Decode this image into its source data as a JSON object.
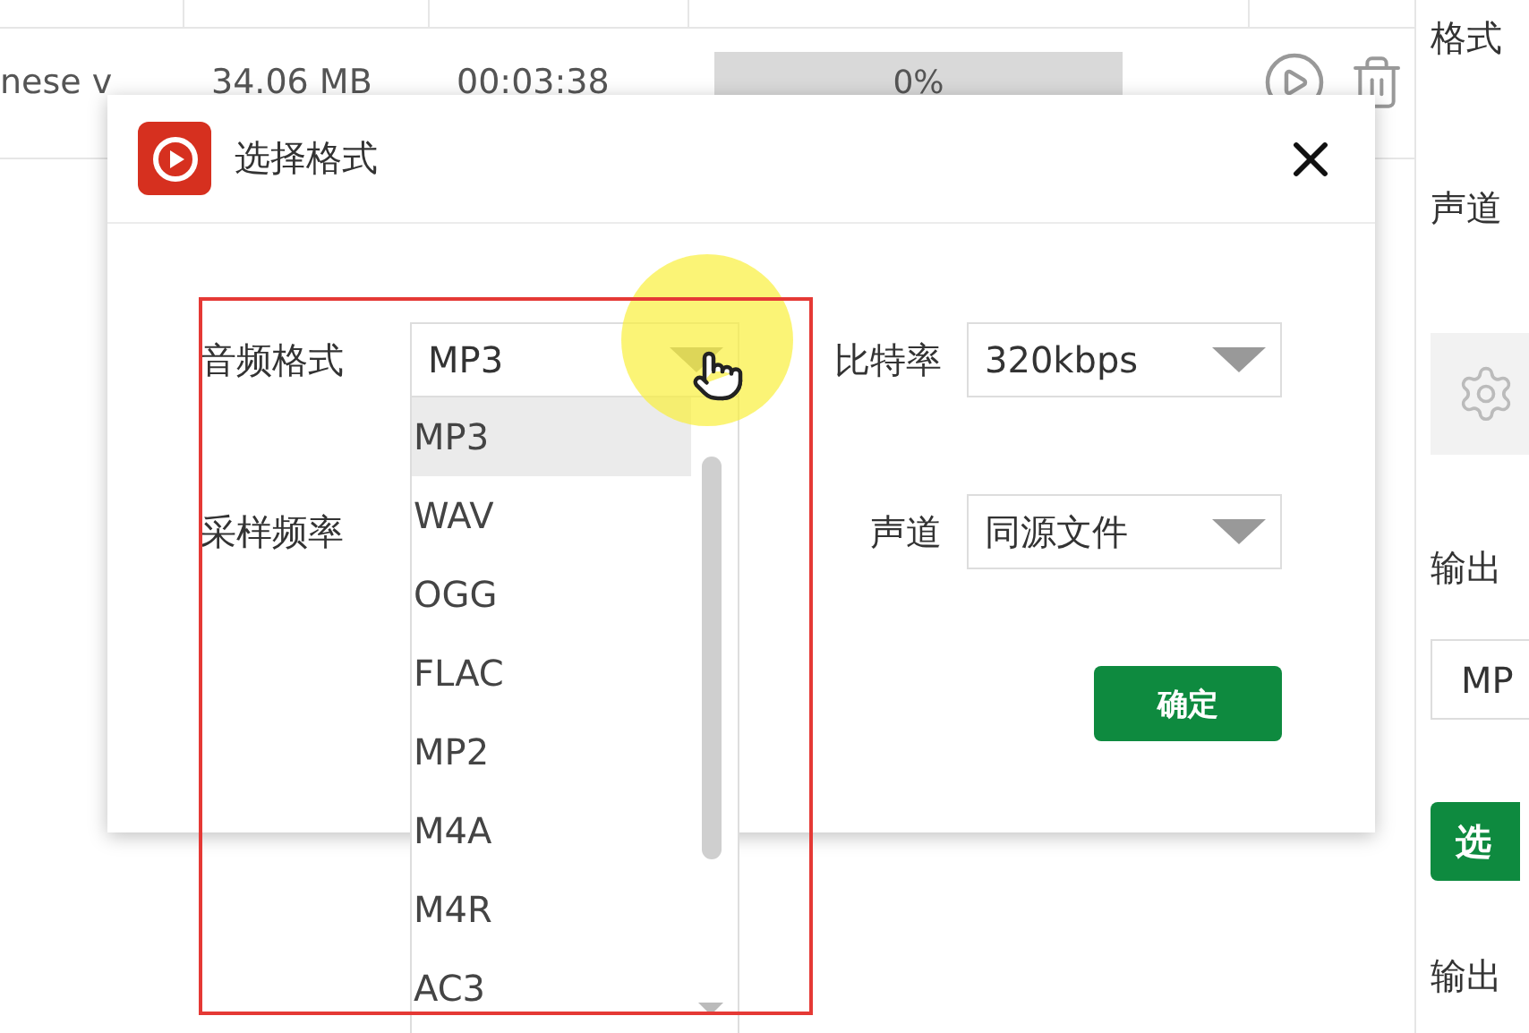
{
  "file_table": {
    "rows": [
      {
        "cells": [
          "nese v",
          "34.06 MB",
          "00:03:38"
        ],
        "progress": {
          "level": 0,
          "reading": "0%"
        }
      }
    ]
  },
  "side_panel": [
    {
      "kind": "label",
      "text": "格式"
    },
    {
      "kind": "label",
      "text": "声道"
    },
    {
      "kind": "settings"
    },
    {
      "kind": "label",
      "text": "输出"
    },
    {
      "kind": "field",
      "value": "MP"
    },
    {
      "kind": "button",
      "text": "选"
    },
    {
      "kind": "label",
      "text": "输出"
    }
  ],
  "dialog": {
    "title": "选择格式",
    "fields": [
      {
        "label": "音频格式",
        "value": "MP3"
      },
      {
        "label": "比特率",
        "value": "320kbps"
      },
      {
        "label": "采样频率"
      },
      {
        "label": "声道",
        "value": "同源文件"
      }
    ],
    "options": [
      {
        "label": "MP3",
        "selected": true
      },
      {
        "label": "WAV",
        "selected": false
      },
      {
        "label": "OGG",
        "selected": false
      },
      {
        "label": "FLAC",
        "selected": false
      },
      {
        "label": "MP2",
        "selected": false
      },
      {
        "label": "M4A",
        "selected": false
      },
      {
        "label": "M4R",
        "selected": false
      },
      {
        "label": "AC3",
        "selected": false
      }
    ],
    "confirm": "确定"
  }
}
